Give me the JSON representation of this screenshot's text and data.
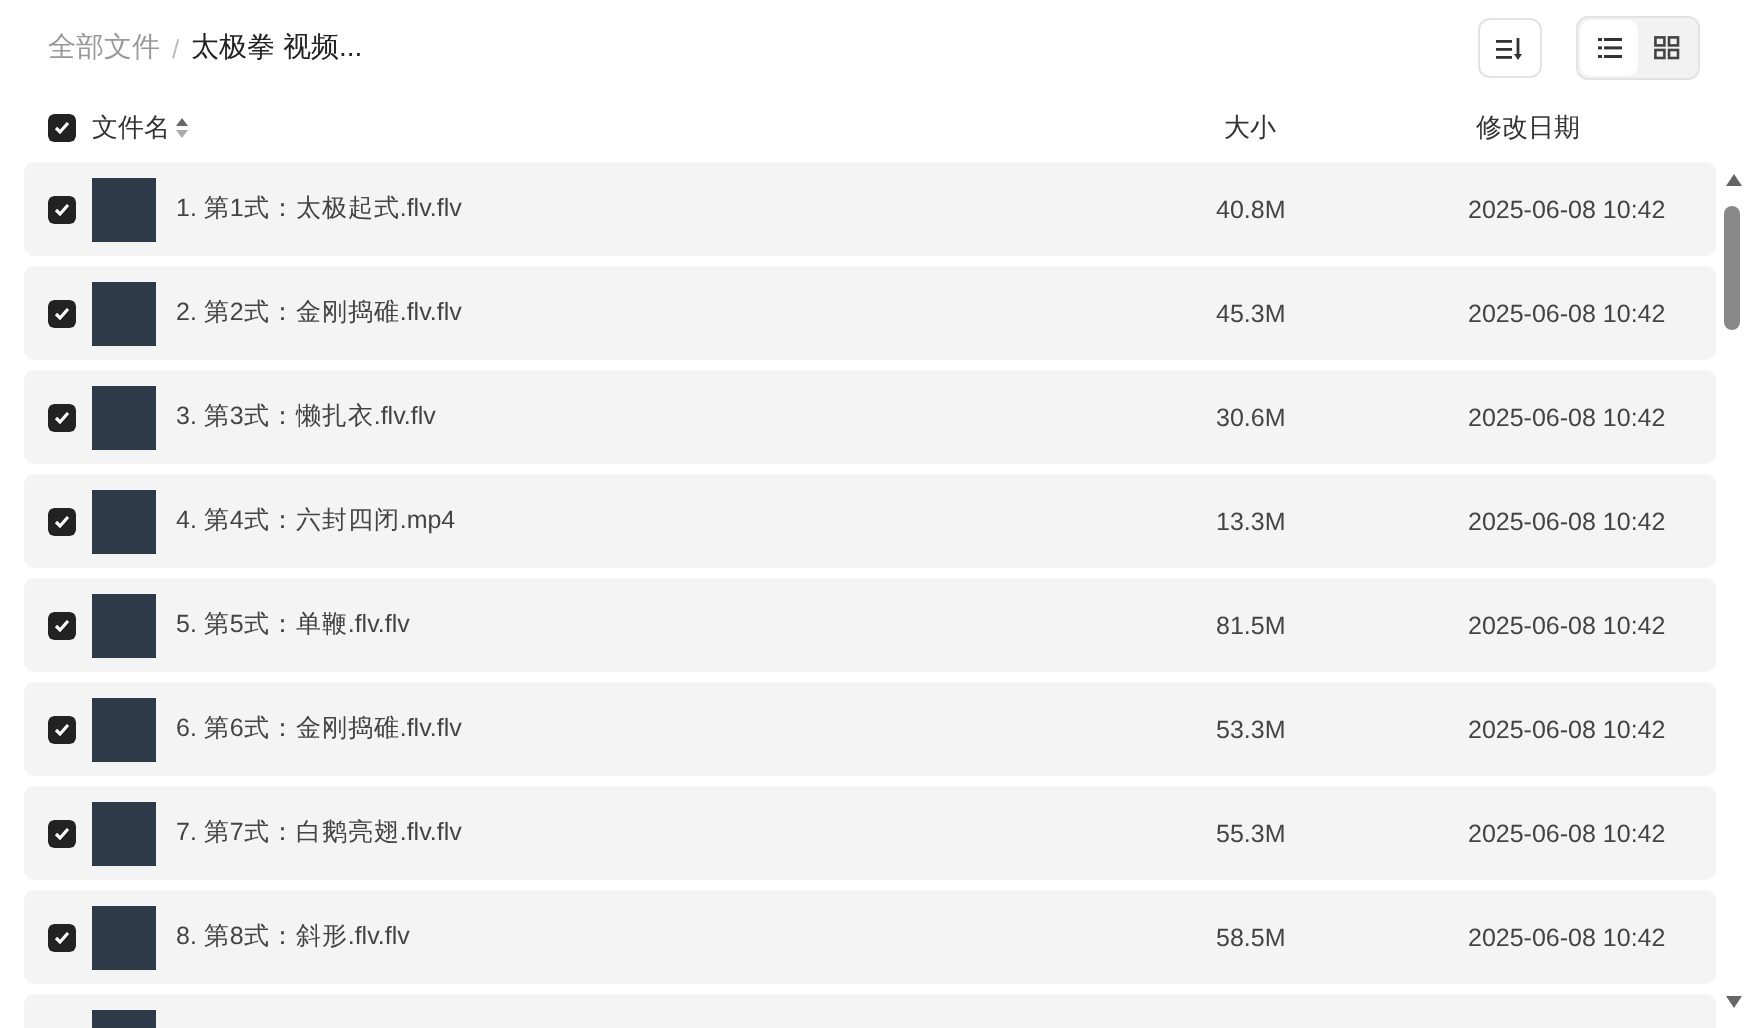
{
  "breadcrumb": {
    "separator": "/",
    "items": [
      "全部文件",
      "太极拳 视频..."
    ]
  },
  "toolbar": {
    "view_modes": [
      {
        "kind": "list",
        "selected": true
      },
      {
        "kind": "grid",
        "selected": false
      }
    ]
  },
  "header": {
    "checked": true,
    "columns": [
      "文件名",
      "大小",
      "修改日期"
    ]
  },
  "rows": [
    {
      "checked": true,
      "name": "1. 第1式：太极起式.flv.flv",
      "size": "40.8M",
      "date": "2025-06-08 10:42"
    },
    {
      "checked": true,
      "name": "2. 第2式：金刚捣碓.flv.flv",
      "size": "45.3M",
      "date": "2025-06-08 10:42"
    },
    {
      "checked": true,
      "name": "3. 第3式：懒扎衣.flv.flv",
      "size": "30.6M",
      "date": "2025-06-08 10:42"
    },
    {
      "checked": true,
      "name": "4. 第4式：六封四闭.mp4",
      "size": "13.3M",
      "date": "2025-06-08 10:42"
    },
    {
      "checked": true,
      "name": "5. 第5式：单鞭.flv.flv",
      "size": "81.5M",
      "date": "2025-06-08 10:42"
    },
    {
      "checked": true,
      "name": "6. 第6式：金刚捣碓.flv.flv",
      "size": "53.3M",
      "date": "2025-06-08 10:42"
    },
    {
      "checked": true,
      "name": "7. 第7式：白鹅亮翅.flv.flv",
      "size": "55.3M",
      "date": "2025-06-08 10:42"
    },
    {
      "checked": true,
      "name": "8. 第8式：斜形.flv.flv",
      "size": "58.5M",
      "date": "2025-06-08 10:42"
    }
  ]
}
